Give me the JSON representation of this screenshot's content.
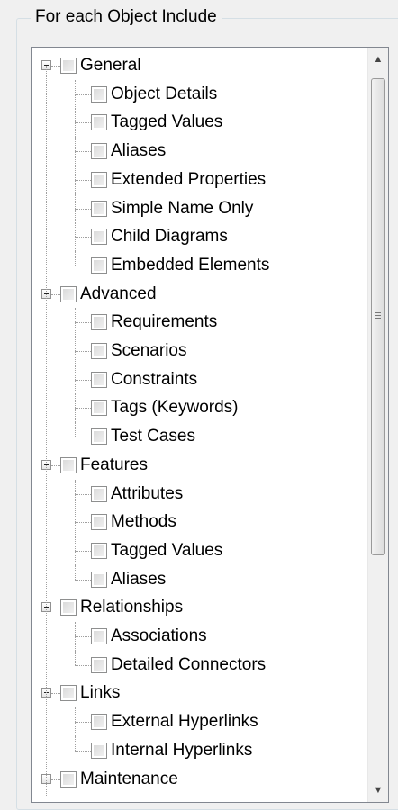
{
  "group": {
    "title": "For each Object Include"
  },
  "tree": {
    "items": [
      {
        "label": "General",
        "level": 0,
        "name": "general"
      },
      {
        "label": "Object Details",
        "level": 1,
        "name": "object-details"
      },
      {
        "label": "Tagged Values",
        "level": 1,
        "name": "tagged-values"
      },
      {
        "label": "Aliases",
        "level": 1,
        "name": "aliases"
      },
      {
        "label": "Extended Properties",
        "level": 1,
        "name": "extended-properties"
      },
      {
        "label": "Simple Name Only",
        "level": 1,
        "name": "simple-name-only"
      },
      {
        "label": "Child Diagrams",
        "level": 1,
        "name": "child-diagrams"
      },
      {
        "label": "Embedded Elements",
        "level": 1,
        "name": "embedded-elements"
      },
      {
        "label": "Advanced",
        "level": 0,
        "name": "advanced"
      },
      {
        "label": "Requirements",
        "level": 1,
        "name": "requirements"
      },
      {
        "label": "Scenarios",
        "level": 1,
        "name": "scenarios"
      },
      {
        "label": "Constraints",
        "level": 1,
        "name": "constraints"
      },
      {
        "label": "Tags (Keywords)",
        "level": 1,
        "name": "tags-keywords"
      },
      {
        "label": "Test Cases",
        "level": 1,
        "name": "test-cases"
      },
      {
        "label": "Features",
        "level": 0,
        "name": "features"
      },
      {
        "label": "Attributes",
        "level": 1,
        "name": "attributes"
      },
      {
        "label": "Methods",
        "level": 1,
        "name": "methods"
      },
      {
        "label": "Tagged Values",
        "level": 1,
        "name": "feature-tagged-values"
      },
      {
        "label": "Aliases",
        "level": 1,
        "name": "feature-aliases"
      },
      {
        "label": "Relationships",
        "level": 0,
        "name": "relationships"
      },
      {
        "label": "Associations",
        "level": 1,
        "name": "associations"
      },
      {
        "label": "Detailed Connectors",
        "level": 1,
        "name": "detailed-connectors"
      },
      {
        "label": "Links",
        "level": 0,
        "name": "links"
      },
      {
        "label": "External Hyperlinks",
        "level": 1,
        "name": "external-hyperlinks"
      },
      {
        "label": "Internal Hyperlinks",
        "level": 1,
        "name": "internal-hyperlinks"
      },
      {
        "label": "Maintenance",
        "level": 0,
        "name": "maintenance"
      }
    ]
  },
  "scrollbar": {
    "up_icon": "chevron-up-icon",
    "down_icon": "chevron-down-icon"
  }
}
